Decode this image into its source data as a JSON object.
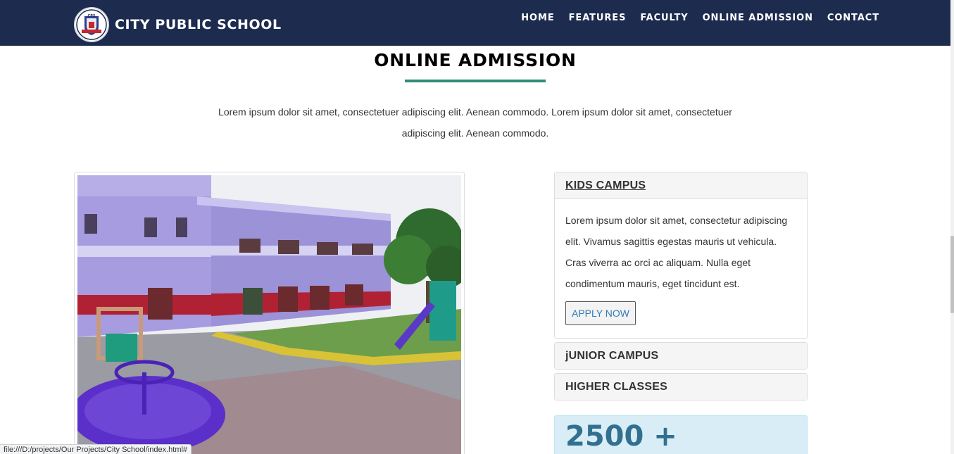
{
  "brand": {
    "name": "CITY PUBLIC SCHOOL",
    "logo_icon": "school-crest-icon"
  },
  "nav": {
    "items": [
      "HOME",
      "FEATURES",
      "FACULTY",
      "ONLINE ADMISSION",
      "CONTACT"
    ]
  },
  "section": {
    "title": "ONLINE ADMISSION",
    "intro_line1": "Lorem ipsum dolor sit amet, consectetuer adipiscing elit. Aenean commodo. Lorem ipsum dolor sit amet, consectetuer",
    "intro_line2": "adipiscing elit. Aenean commodo.",
    "accent_color": "#2f8c78"
  },
  "accordion": [
    {
      "title": "KIDS CAMPUS",
      "body": "Lorem ipsum dolor sit amet, consectetur adipiscing elit. Vivamus sagittis egestas mauris ut vehicula. Cras viverra ac orci ac aliquam. Nulla eget condimentum mauris, eget tincidunt est.",
      "button": "APPLY NOW"
    },
    {
      "title": "jUNIOR CAMPUS"
    },
    {
      "title": "HIGHER CLASSES"
    }
  ],
  "stat": {
    "value": "2500 +"
  },
  "status_bar": {
    "url": "file:///D:/projects/Our Projects/City School/index.html#"
  },
  "colors": {
    "navbar": "#1d2b4f",
    "stat_bg": "#d9edf7",
    "stat_text": "#31708f",
    "link": "#337ab7"
  }
}
